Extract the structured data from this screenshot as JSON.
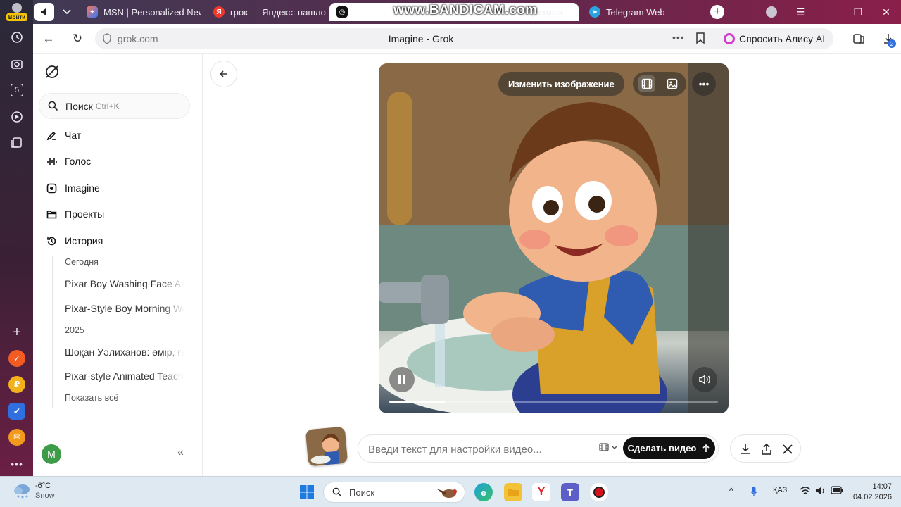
{
  "leftbar": {
    "login_label": "Войти",
    "badge": "5"
  },
  "tabs": [
    {
      "label": "MSN | Personalized New",
      "icon": "msn-icon"
    },
    {
      "label": "грок — Яндекс: нашлось",
      "icon": "yandex-icon"
    },
    {
      "label": "",
      "icon": "grok-tab-icon"
    },
    {
      "label": "е тұрамыз",
      "icon": "tab-icon"
    },
    {
      "label": "Telegram Web",
      "icon": "telegram-icon"
    }
  ],
  "watermark": "www.BANDICAM.com",
  "addressbar": {
    "url": "grok.com",
    "page_title": "Imagine - Grok",
    "alice_label": "Спросить Алису AI",
    "downloads_badge": "2"
  },
  "sidebar": {
    "search_label": "Поиск",
    "search_shortcut": "Ctrl+K",
    "nav": [
      {
        "label": "Чат",
        "icon": "chat-icon"
      },
      {
        "label": "Голос",
        "icon": "voice-icon"
      },
      {
        "label": "Imagine",
        "icon": "imagine-icon"
      },
      {
        "label": "Проекты",
        "icon": "folder-icon"
      },
      {
        "label": "История",
        "icon": "history-icon"
      }
    ],
    "history": {
      "today_label": "Сегодня",
      "today": [
        "Pixar Boy Washing Face Animation",
        "Pixar-Style Boy Morning Washing"
      ],
      "year_label": "2025",
      "year": [
        "Шоқан Уәлиханов: өмір, ғылым",
        "Pixar-style Animated Teacher"
      ],
      "show_all": "Показать всё"
    },
    "avatar_letter": "M"
  },
  "video": {
    "edit_label": "Изменить изображение",
    "progress": 0.17
  },
  "prompt": {
    "placeholder": "Введи текст для настройки видео...",
    "submit_label": "Сделать видео"
  },
  "taskbar": {
    "weather_temp": "-6°C",
    "weather_desc": "Snow",
    "search_label": "Поиск",
    "lang": "ҚАЗ",
    "time": "14:07",
    "date": "04.02.2026"
  },
  "colors": {
    "accent_alice": "#d43bd0",
    "make_button": "#111111",
    "avatar": "#3e9b47"
  }
}
